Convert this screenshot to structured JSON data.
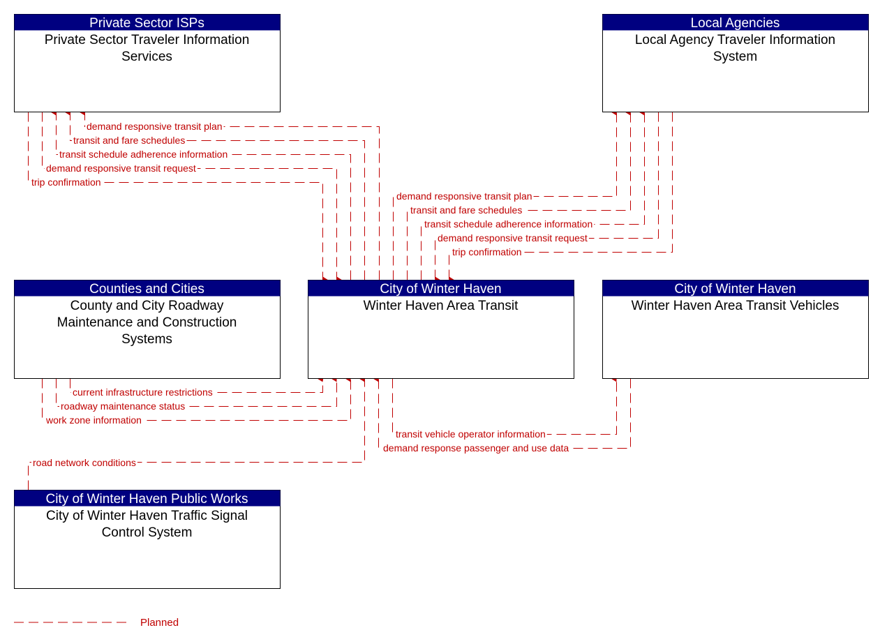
{
  "diagram": {
    "colors": {
      "header": "#000080",
      "flow": "#c00000",
      "border": "#000000"
    },
    "nodes": [
      {
        "id": "isp",
        "header": "Private Sector ISPs",
        "body": [
          "Private Sector Traveler Information",
          "Services"
        ]
      },
      {
        "id": "local",
        "header": "Local Agencies",
        "body": [
          "Local Agency Traveler Information",
          "System"
        ]
      },
      {
        "id": "counties",
        "header": "Counties and Cities",
        "body": [
          "County and City Roadway",
          "Maintenance and Construction",
          "Systems"
        ]
      },
      {
        "id": "wht",
        "header": "City of Winter Haven",
        "body": [
          "Winter Haven Area Transit"
        ]
      },
      {
        "id": "vehicles",
        "header": "City of Winter Haven",
        "body": [
          "Winter Haven Area Transit Vehicles"
        ]
      },
      {
        "id": "signals",
        "header": "City of Winter Haven Public Works",
        "body": [
          "City of Winter Haven Traffic Signal",
          "Control System"
        ]
      }
    ],
    "flows": [
      {
        "label": "demand responsive transit plan",
        "from": "wht",
        "to": "isp",
        "status": "Planned"
      },
      {
        "label": "transit and fare schedules",
        "from": "wht",
        "to": "isp",
        "status": "Planned"
      },
      {
        "label": "transit schedule adherence information",
        "from": "wht",
        "to": "isp",
        "status": "Planned"
      },
      {
        "label": "demand responsive transit request",
        "from": "isp",
        "to": "wht",
        "status": "Planned"
      },
      {
        "label": "trip confirmation",
        "from": "isp",
        "to": "wht",
        "status": "Planned"
      },
      {
        "label": "demand responsive transit plan",
        "from": "wht",
        "to": "local",
        "status": "Planned"
      },
      {
        "label": "transit and fare schedules",
        "from": "wht",
        "to": "local",
        "status": "Planned"
      },
      {
        "label": "transit schedule adherence information",
        "from": "wht",
        "to": "local",
        "status": "Planned"
      },
      {
        "label": "demand responsive transit request",
        "from": "local",
        "to": "wht",
        "status": "Planned"
      },
      {
        "label": "trip confirmation",
        "from": "local",
        "to": "wht",
        "status": "Planned"
      },
      {
        "label": "current infrastructure restrictions",
        "from": "counties",
        "to": "wht",
        "status": "Planned"
      },
      {
        "label": "roadway maintenance status",
        "from": "counties",
        "to": "wht",
        "status": "Planned"
      },
      {
        "label": "work zone information",
        "from": "counties",
        "to": "wht",
        "status": "Planned"
      },
      {
        "label": "road network conditions",
        "from": "signals",
        "to": "wht",
        "status": "Planned"
      },
      {
        "label": "transit vehicle operator information",
        "from": "wht",
        "to": "vehicles",
        "status": "Planned"
      },
      {
        "label": "demand response passenger and use data",
        "from": "vehicles",
        "to": "wht",
        "status": "Planned"
      }
    ],
    "legend": {
      "label": "Planned"
    }
  }
}
